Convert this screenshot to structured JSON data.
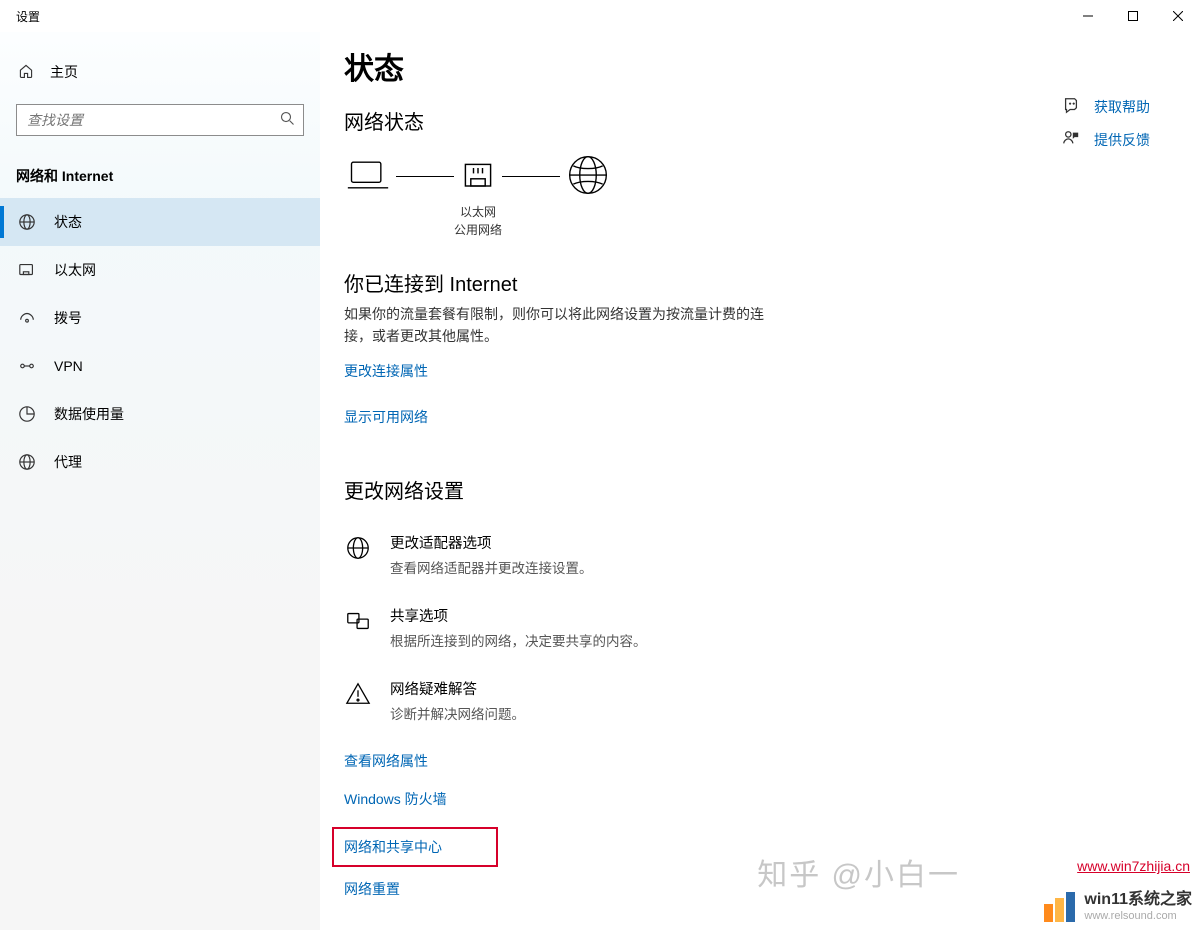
{
  "window": {
    "title": "设置"
  },
  "sidebar": {
    "home_label": "主页",
    "search_placeholder": "查找设置",
    "section_title": "网络和 Internet",
    "items": [
      {
        "label": "状态"
      },
      {
        "label": "以太网"
      },
      {
        "label": "拨号"
      },
      {
        "label": "VPN"
      },
      {
        "label": "数据使用量"
      },
      {
        "label": "代理"
      }
    ]
  },
  "main": {
    "page_title": "状态",
    "network_status_heading": "网络状态",
    "ethernet_label": "以太网",
    "ethernet_sub": "公用网络",
    "connected_heading": "你已连接到 Internet",
    "connected_desc": "如果你的流量套餐有限制，则你可以将此网络设置为按流量计费的连接，或者更改其他属性。",
    "change_conn_link": "更改连接属性",
    "show_networks_link": "显示可用网络",
    "change_settings_heading": "更改网络设置",
    "rows": [
      {
        "t1": "更改适配器选项",
        "t2": "查看网络适配器并更改连接设置。"
      },
      {
        "t1": "共享选项",
        "t2": "根据所连接到的网络，决定要共享的内容。"
      },
      {
        "t1": "网络疑难解答",
        "t2": "诊断并解决网络问题。"
      }
    ],
    "links": [
      "查看网络属性",
      "Windows 防火墙",
      "网络和共享中心",
      "网络重置"
    ]
  },
  "help": {
    "get_help": "获取帮助",
    "feedback": "提供反馈"
  },
  "watermarks": {
    "zhihu": "知乎 @小白一",
    "url1": "www.win7zhijia.cn",
    "brand": "win11系统之家",
    "brand_sub": "www.relsound.com"
  }
}
